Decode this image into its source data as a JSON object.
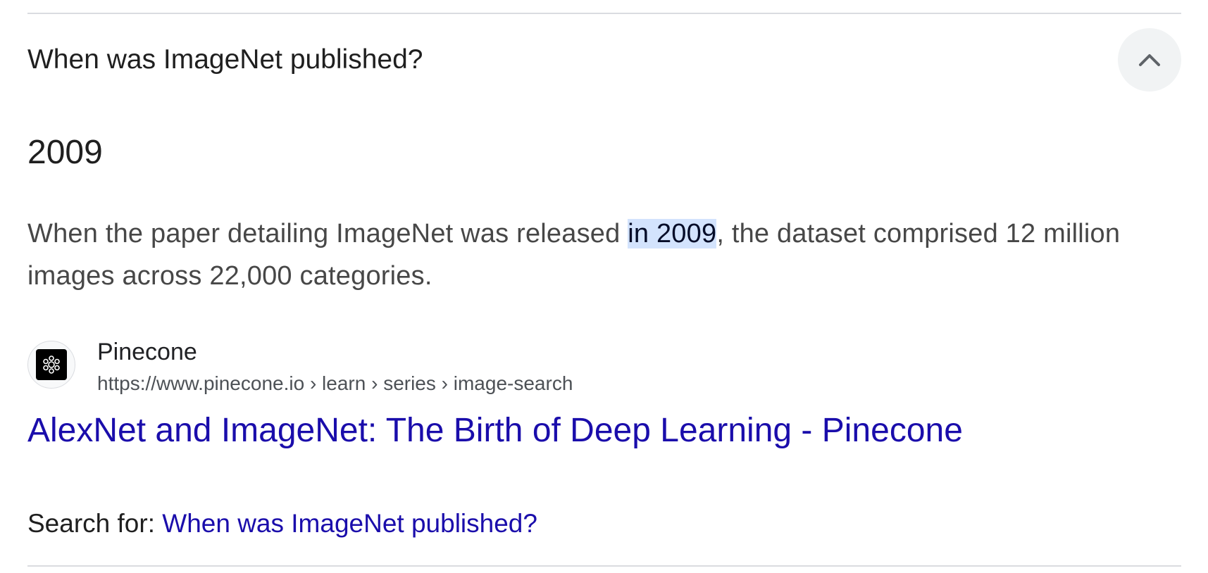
{
  "faq": {
    "question": "When was ImageNet published?",
    "collapse_icon": "chevron-up-icon",
    "answer_short": "2009",
    "snippet": {
      "before": "When the paper detailing ImageNet was released ",
      "highlight": "in 2009",
      "after": ", the dataset comprised 12 million images across 22,000 categories."
    },
    "source": {
      "favicon_icon": "pinecone-logo-icon",
      "site_name": "Pinecone",
      "url_breadcrumb": "https://www.pinecone.io › learn › series › image-search",
      "title": "AlexNet and ImageNet: The Birth of Deep Learning - Pinecone"
    },
    "search_for": {
      "label": "Search for: ",
      "query": "When was ImageNet published?"
    }
  },
  "colors": {
    "link": "#1a0dab",
    "highlight_bg": "#d3e3fd",
    "text_primary": "#1f1f1f",
    "text_secondary": "#474747",
    "divider": "#dadce0"
  }
}
